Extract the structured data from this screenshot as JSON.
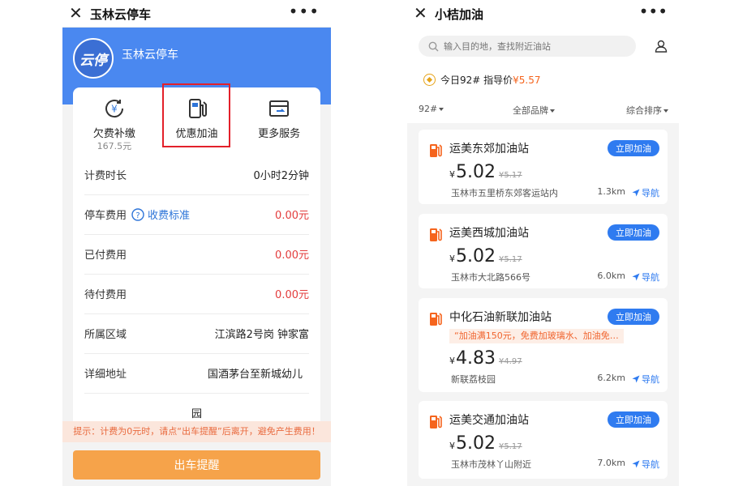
{
  "left": {
    "title": "玉林云停车",
    "logo_text": "云停",
    "brand_name": "玉林云停车",
    "services": [
      {
        "label": "欠费补缴",
        "sub": "167.5元"
      },
      {
        "label": "优惠加油",
        "sub": ""
      },
      {
        "label": "更多服务",
        "sub": ""
      }
    ],
    "rows": {
      "duration": {
        "label": "计费时长",
        "value": "0小时2分钟"
      },
      "fee": {
        "label": "停车费用",
        "standard": "收费标准",
        "value": "0.00元"
      },
      "paid": {
        "label": "已付费用",
        "value": "0.00元"
      },
      "pending": {
        "label": "待付费用",
        "value": "0.00元"
      },
      "area": {
        "label": "所属区域",
        "value": "江滨路2号岗 钟家富"
      },
      "address": {
        "label": "详细地址",
        "value": "国酒茅台至新城幼儿",
        "value2": "园"
      }
    },
    "tip": "提示：计费为0元时，请点“出车提醒”后离开，避免产生费用！",
    "exit_button": "出车提醒"
  },
  "right": {
    "title": "小桔加油",
    "search_placeholder": "输入目的地，查找附近油站",
    "guide_label": "今日92# 指导价",
    "guide_price": "¥5.57",
    "filters": {
      "fuel": "92#",
      "brand": "全部品牌",
      "sort": "综合排序"
    },
    "stations": [
      {
        "name": "运美东郊加油站",
        "button": "立即加油",
        "yen": "¥",
        "price": "5.02",
        "old_price": "¥5.17",
        "promo": "",
        "address": "玉林市五里桥东郊客运站内",
        "distance": "1.3km",
        "nav": "导航"
      },
      {
        "name": "运美西城加油站",
        "button": "立即加油",
        "yen": "¥",
        "price": "5.02",
        "old_price": "¥5.17",
        "promo": "",
        "address": "玉林市大北路566号",
        "distance": "6.0km",
        "nav": "导航"
      },
      {
        "name": "中化石油新联加油站",
        "button": "立即加油",
        "yen": "¥",
        "price": "4.83",
        "old_price": "¥4.97",
        "promo": "“加油满150元，免费加玻璃水、加油免…",
        "address": "新联荔枝园",
        "distance": "6.2km",
        "nav": "导航"
      },
      {
        "name": "运美交通加油站",
        "button": "立即加油",
        "yen": "¥",
        "price": "5.02",
        "old_price": "¥5.17",
        "promo": "",
        "address": "玉林市茂林丫山附近",
        "distance": "7.0km",
        "nav": "导航"
      }
    ]
  },
  "colors": {
    "blue": "#4a88f0",
    "red": "#e33c3c",
    "orange": "#f6a34a",
    "accent_blue": "#2f7bf0",
    "pump_orange": "#f5641d"
  }
}
